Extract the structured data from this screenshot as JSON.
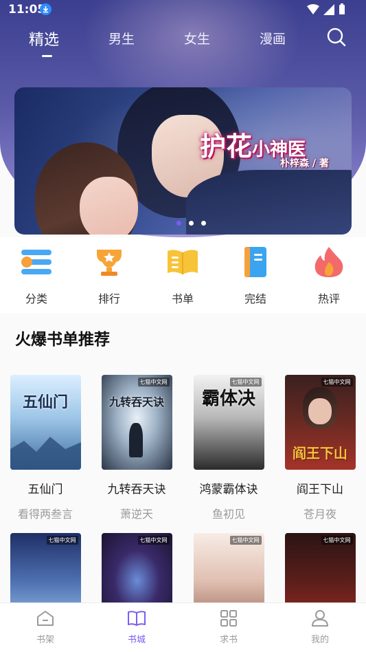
{
  "status_bar": {
    "time": "11:05"
  },
  "top_tabs": [
    {
      "label": "精选",
      "active": true
    },
    {
      "label": "男生",
      "active": false
    },
    {
      "label": "女生",
      "active": false
    },
    {
      "label": "漫画",
      "active": false
    }
  ],
  "banner": {
    "title_large": "护花",
    "title_small": "小神医",
    "author": "朴梓森 / 著",
    "slide_count": 3,
    "active_slide": 1
  },
  "categories": [
    {
      "label": "分类",
      "icon": "category-icon"
    },
    {
      "label": "排行",
      "icon": "trophy-icon"
    },
    {
      "label": "书单",
      "icon": "open-book-icon"
    },
    {
      "label": "完结",
      "icon": "notebook-icon"
    },
    {
      "label": "热评",
      "icon": "flame-icon"
    }
  ],
  "section": {
    "title": "火爆书单推荐"
  },
  "books_row1": [
    {
      "title": "五仙门",
      "author": "看得两叁言",
      "cover_text": "五仙门",
      "tag": "",
      "colors": [
        "#cfe6f5",
        "#5d8fc0"
      ]
    },
    {
      "title": "九转吞天诀",
      "author": "萧逆天",
      "cover_text": "九转吞天诀",
      "tag": "七猫中文网",
      "colors": [
        "#d6dfe8",
        "#2e3b4f"
      ]
    },
    {
      "title": "鸿蒙霸体诀",
      "author": "鱼初见",
      "cover_text": "霸体决",
      "tag": "七猫中文网",
      "colors": [
        "#e8e8e8",
        "#2a2a2a"
      ]
    },
    {
      "title": "阎王下山",
      "author": "苍月夜",
      "cover_text": "阎王下山",
      "tag": "七猫中文网",
      "colors": [
        "#3a1a18",
        "#8a2a20"
      ]
    }
  ],
  "books_row2": [
    {
      "tag": "七猫中文网",
      "colors": [
        "#2b3f7a",
        "#7aa2d8"
      ]
    },
    {
      "tag": "七猫中文网",
      "colors": [
        "#1b1430",
        "#c0395a"
      ]
    },
    {
      "tag": "七猫中文网",
      "colors": [
        "#f3e0d8",
        "#b78a7a"
      ]
    },
    {
      "tag": "七猫中文网",
      "colors": [
        "#2a1414",
        "#9a2a22"
      ]
    }
  ],
  "bottom_nav": [
    {
      "label": "书架",
      "icon": "bookshelf-icon",
      "active": false
    },
    {
      "label": "书城",
      "icon": "book-store-icon",
      "active": true
    },
    {
      "label": "求书",
      "icon": "grid-icon",
      "active": false
    },
    {
      "label": "我的",
      "icon": "profile-icon",
      "active": false
    }
  ],
  "colors": {
    "accent": "#7b5cf0",
    "hero_top": "#3b3f8f",
    "hero_bottom": "#a79ad8"
  }
}
